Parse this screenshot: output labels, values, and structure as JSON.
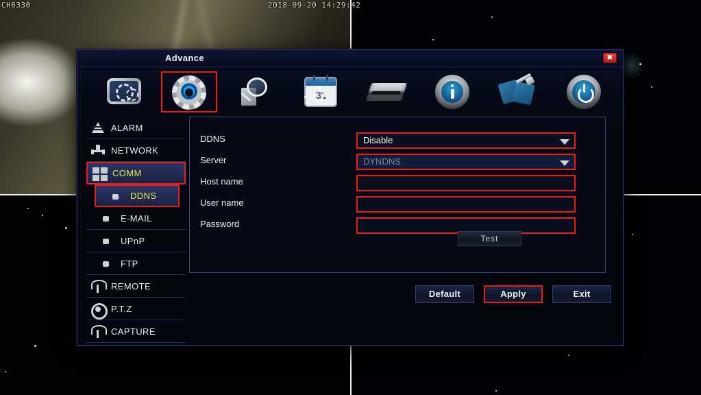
{
  "osd": {
    "channel_label": "CH6330",
    "timestamp": "2018-09-20 14:29:42"
  },
  "dialog": {
    "title": "Advance",
    "close_label": "✖"
  },
  "toolbar": {
    "items": [
      {
        "name": "display-settings-icon",
        "label": "Display",
        "selected": false
      },
      {
        "name": "advance-gear-icon",
        "label": "Advance",
        "selected": true
      },
      {
        "name": "search-magnifier-icon",
        "label": "Search",
        "selected": false
      },
      {
        "name": "calendar-search-icon",
        "label": "Record Search",
        "selected": false,
        "day": "31"
      },
      {
        "name": "hdd-icon",
        "label": "HDD",
        "selected": false
      },
      {
        "name": "info-icon",
        "label": "Info",
        "selected": false
      },
      {
        "name": "maintenance-tools-icon",
        "label": "Maintain",
        "selected": false
      },
      {
        "name": "power-icon",
        "label": "Shutdown",
        "selected": false
      }
    ]
  },
  "sidebar": {
    "items": [
      {
        "label": "ALARM",
        "icon": "alarm-cone-icon",
        "active": false,
        "sub": false
      },
      {
        "label": "NETWORK",
        "icon": "network-node-icon",
        "active": false,
        "sub": false
      },
      {
        "label": "COMM",
        "icon": "comm-grid-icon",
        "active": true,
        "sub": false
      },
      {
        "label": "DDNS",
        "icon": "bullet-icon",
        "active": true,
        "sub": true
      },
      {
        "label": "E-MAIL",
        "icon": "bullet-icon",
        "active": false,
        "sub": true
      },
      {
        "label": "UPnP",
        "icon": "bullet-icon",
        "active": false,
        "sub": true
      },
      {
        "label": "FTP",
        "icon": "bullet-icon",
        "active": false,
        "sub": true
      },
      {
        "label": "REMOTE",
        "icon": "antenna-icon",
        "active": false,
        "sub": false
      },
      {
        "label": "P.T.Z",
        "icon": "ptz-dome-icon",
        "active": false,
        "sub": false
      },
      {
        "label": "CAPTURE",
        "icon": "antenna-icon",
        "active": false,
        "sub": false
      }
    ]
  },
  "form": {
    "rows": [
      {
        "label": "DDNS",
        "value": "Disable",
        "type": "select",
        "disabled": false,
        "highlighted": true
      },
      {
        "label": "Server",
        "value": "DYNDNS",
        "type": "select",
        "disabled": true,
        "highlighted": true
      },
      {
        "label": "Host name",
        "value": "",
        "type": "text",
        "disabled": false,
        "highlighted": true
      },
      {
        "label": "User name",
        "value": "",
        "type": "text",
        "disabled": false,
        "highlighted": true
      },
      {
        "label": "Password",
        "value": "",
        "type": "password",
        "disabled": false,
        "highlighted": true
      }
    ],
    "test_button": "Test"
  },
  "actions": {
    "default_label": "Default",
    "apply_label": "Apply",
    "exit_label": "Exit"
  },
  "colors": {
    "highlight_red": "#ee1b1b",
    "active_text_yellow": "#e8e84a",
    "dialog_bg": "#05070f",
    "titlebar_bg": "#0a1029",
    "text": "#e7eaf1"
  }
}
